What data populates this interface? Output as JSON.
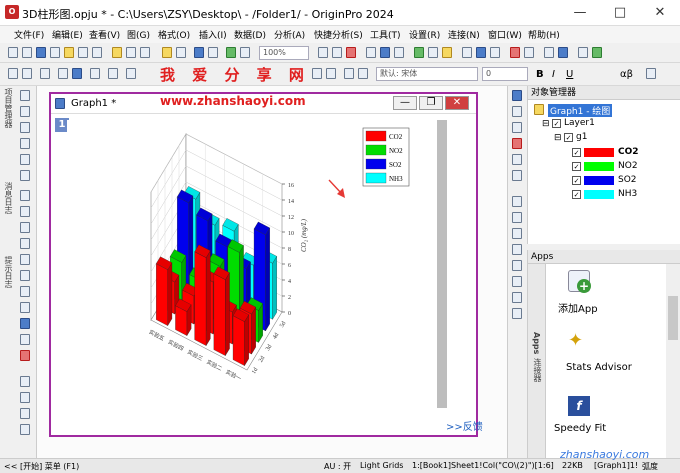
{
  "window": {
    "title": "3D柱形图.opju * - C:\\Users\\ZSY\\Desktop\\ - /Folder1/ - OriginPro 2024"
  },
  "menu": [
    "文件(F)",
    "编辑(E)",
    "查看(V)",
    "图(G)",
    "格式(O)",
    "插入(I)",
    "数据(D)",
    "分析(A)",
    "快捷分析(S)",
    "工具(T)",
    "设置(R)",
    "连接(N)",
    "窗口(W)",
    "帮助(H)"
  ],
  "toolbar": {
    "zoom": "100%",
    "font": "默认: 宋体",
    "fontsize": "0",
    "bold": "B",
    "italic": "I",
    "underline": "U",
    "greek": "αβ"
  },
  "left_labels": {
    "project": "项目管理器",
    "message": "消息日志",
    "hint": "提示日志"
  },
  "graph": {
    "title": "Graph1 *",
    "layer": "1"
  },
  "chart_data": {
    "type": "3d-bar",
    "legend": [
      "CO2",
      "NO2",
      "SO2",
      "NH3"
    ],
    "colors": [
      "#ff0000",
      "#00dd00",
      "#0000ee",
      "#00ffff"
    ],
    "z_axis_label": "CO₂ (mg/L)",
    "z_ticks": [
      "0",
      "2",
      "4",
      "6",
      "8",
      "10",
      "12",
      "14",
      "16"
    ],
    "row_labels": [
      "实验一",
      "实验二",
      "实验三",
      "实验四",
      "实验五"
    ],
    "col_labels": [
      "1d",
      "2d",
      "3d",
      "4d",
      "5d"
    ]
  },
  "object_manager": {
    "title": "对象管理器",
    "graph": "Graph1 - 绘图",
    "layer": "Layer1",
    "group": "g1",
    "items": [
      {
        "name": "CO2",
        "color": "#ff0000",
        "bold": true
      },
      {
        "name": "NO2",
        "color": "#00ff00"
      },
      {
        "name": "SO2",
        "color": "#0000ee"
      },
      {
        "name": "NH3",
        "color": "#00ffff"
      }
    ]
  },
  "apps": {
    "title": "Apps",
    "items": [
      "添加App",
      "Stats Advisor",
      "Speedy Fit"
    ],
    "tabs": [
      "Apps",
      "连接器"
    ]
  },
  "status": {
    "start": "<< [开始] 菜单 (F1)",
    "au": "AU : 开",
    "grid": "Light Grids",
    "cell": "1:[Book1]Sheet1!Col(\"CO\\(2)\")[1:6]",
    "size": "22KB",
    "graph": "[Graph1]1!",
    "unit": "弧度"
  },
  "watermark": {
    "text": "我 爱 分 享 网",
    "url": "www.zhanshaoyi.com",
    "corner": "zhanshaoyi.com"
  },
  "feedback": ">>反馈"
}
